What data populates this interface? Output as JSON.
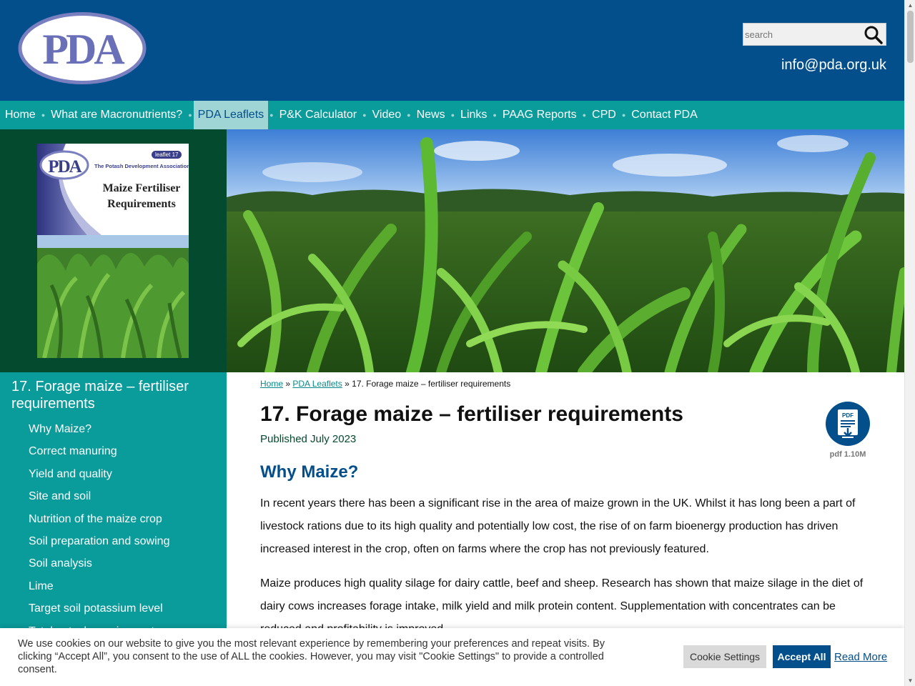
{
  "header": {
    "logo_text": "PDA",
    "search": {
      "placeholder": "search"
    },
    "email": "info@pda.org.uk"
  },
  "nav": {
    "items": [
      {
        "label": "Home",
        "active": false
      },
      {
        "label": "What are Macronutrients?",
        "active": false
      },
      {
        "label": "PDA Leaflets",
        "active": true
      },
      {
        "label": "P&K Calculator",
        "active": false
      },
      {
        "label": "Video",
        "active": false
      },
      {
        "label": "News",
        "active": false
      },
      {
        "label": "Links",
        "active": false
      },
      {
        "label": "PAAG Reports",
        "active": false
      },
      {
        "label": "CPD",
        "active": false
      },
      {
        "label": "Contact PDA",
        "active": false
      }
    ]
  },
  "cover": {
    "logo_text": "PDA",
    "leaflet_badge": "leaflet 17",
    "association": "The Potash Development Association",
    "title_line1": "Maize Fertiliser",
    "title_line2": "Requirements"
  },
  "sidebar": {
    "title": "17. Forage maize – fertiliser requirements",
    "items": [
      "Why Maize?",
      "Correct manuring",
      "Yield and quality",
      "Site and soil",
      "Nutrition of the maize crop",
      "Soil preparation and sowing",
      "Soil analysis",
      "Lime",
      "Target soil potassium level",
      "Total potash requirement"
    ]
  },
  "breadcrumb": {
    "home": "Home",
    "separator": "»",
    "leaflets": "PDA Leaflets",
    "current": "17. Forage maize – fertiliser requirements"
  },
  "article": {
    "title": "17. Forage maize – fertiliser requirements",
    "published": "Published July 2023",
    "pdf_label": "PDF",
    "pdf_size": "pdf 1.10M",
    "section_heading": "Why Maize?",
    "paragraph1": "In recent years there has been a significant rise in the area of maize grown in the UK. Whilst it has long been a part of livestock rations due to its high quality and potentially low cost, the rise of on farm bioenergy production has driven increased interest in the crop, often on farms where the crop has not previously featured.",
    "paragraph2": "Maize produces high quality silage for dairy cattle, beef and sheep. Research has shown that maize silage in the diet of dairy cows increases forage intake, milk yield and milk protein content. Supplementation with concentrates can be reduced and profitability is improved."
  },
  "cookie": {
    "text": "We use cookies on our website to give you the most relevant experience by remembering your preferences and repeat visits. By clicking “Accept All”, you consent to the use of ALL the cookies. However, you may visit \"Cookie Settings\" to provide a controlled consent.",
    "settings_label": "Cookie Settings",
    "accept_label": "Accept All",
    "read_more_label": "Read More"
  },
  "colors": {
    "header_blue": "#034f8c",
    "nav_teal": "#0a9b9b",
    "nav_active": "#9fd5d5",
    "sidebar_dark_green": "#044a2e"
  }
}
